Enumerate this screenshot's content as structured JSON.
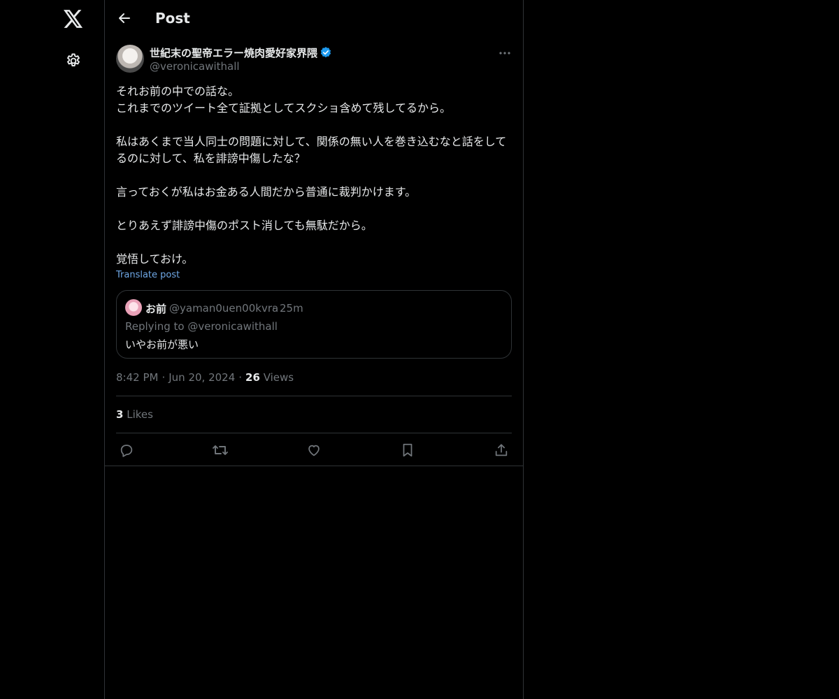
{
  "nav": {
    "logo_icon": "x-logo-icon",
    "settings_icon": "gear-icon"
  },
  "header": {
    "back_icon": "arrow-left-icon",
    "title": "Post"
  },
  "post": {
    "author": {
      "display_name": "世紀末の聖帝エラー焼肉愛好家界隈",
      "handle": "@veronicawithall",
      "verified": true
    },
    "text": "それお前の中での話な。\nこれまでのツイート全て証拠としてスクショ含めて残してるから。\n\n私はあくまで当人同士の問題に対して、関係の無い人を巻き込むなと話をしてるのに対して、私を誹謗中傷したな？\n\n言っておくが私はお金ある人間だから普通に裁判かけます。\n\nとりあえず誹謗中傷のポスト消しても無駄だから。\n\n覚悟しておけ。",
    "translate_label": "Translate post",
    "quote": {
      "display_name": "お前",
      "handle": "@yaman0uen00kvra",
      "time": "25m",
      "replying_to": "Replying to @veronicawithall",
      "text": "いやお前が悪い"
    },
    "time": "8:42 PM",
    "date": "Jun 20, 2024",
    "views_count": "26",
    "views_label": "Views",
    "likes_count": "3",
    "likes_label": "Likes"
  },
  "colors": {
    "background": "#000000",
    "text_primary": "#e7e9ea",
    "text_secondary": "#71767b",
    "border": "#2f3336",
    "link": "#6fa8e6",
    "verified": "#1d9bf0"
  }
}
